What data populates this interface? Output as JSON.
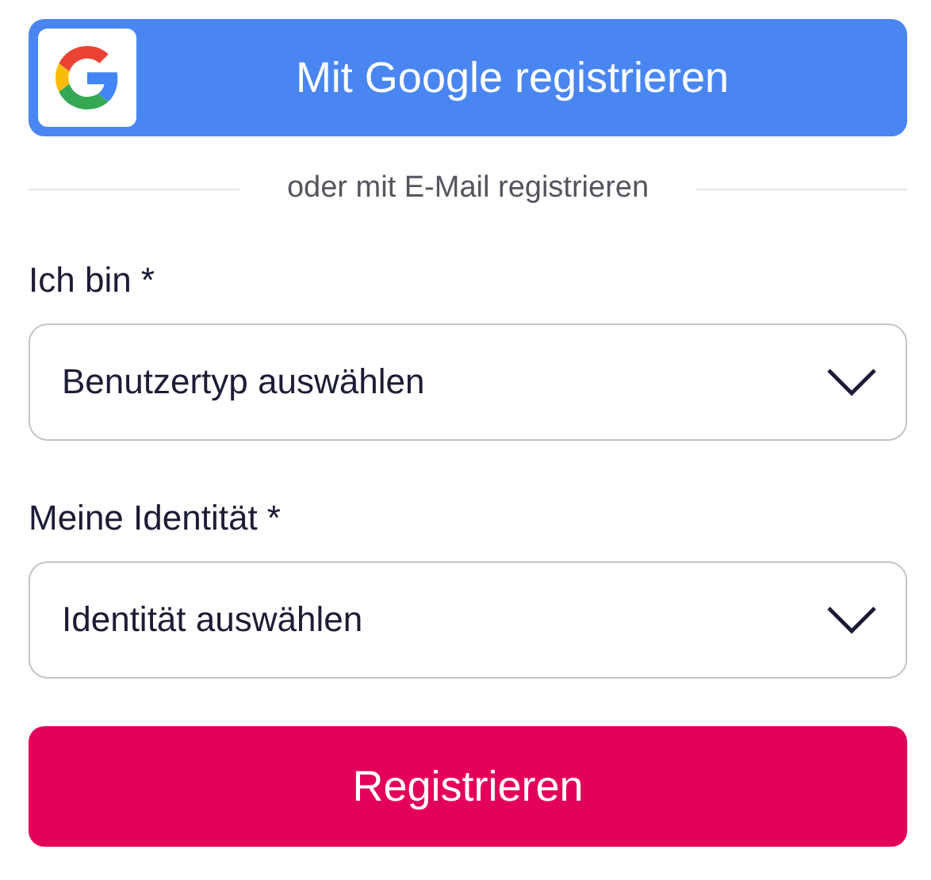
{
  "google_button": {
    "label": "Mit Google registrieren"
  },
  "divider": {
    "text": "oder mit E-Mail registrieren"
  },
  "fields": [
    {
      "label": "Ich bin *",
      "placeholder": "Benutzertyp auswählen"
    },
    {
      "label": "Meine Identität *",
      "placeholder": "Identität auswählen"
    }
  ],
  "submit_button": {
    "label": "Registrieren"
  }
}
